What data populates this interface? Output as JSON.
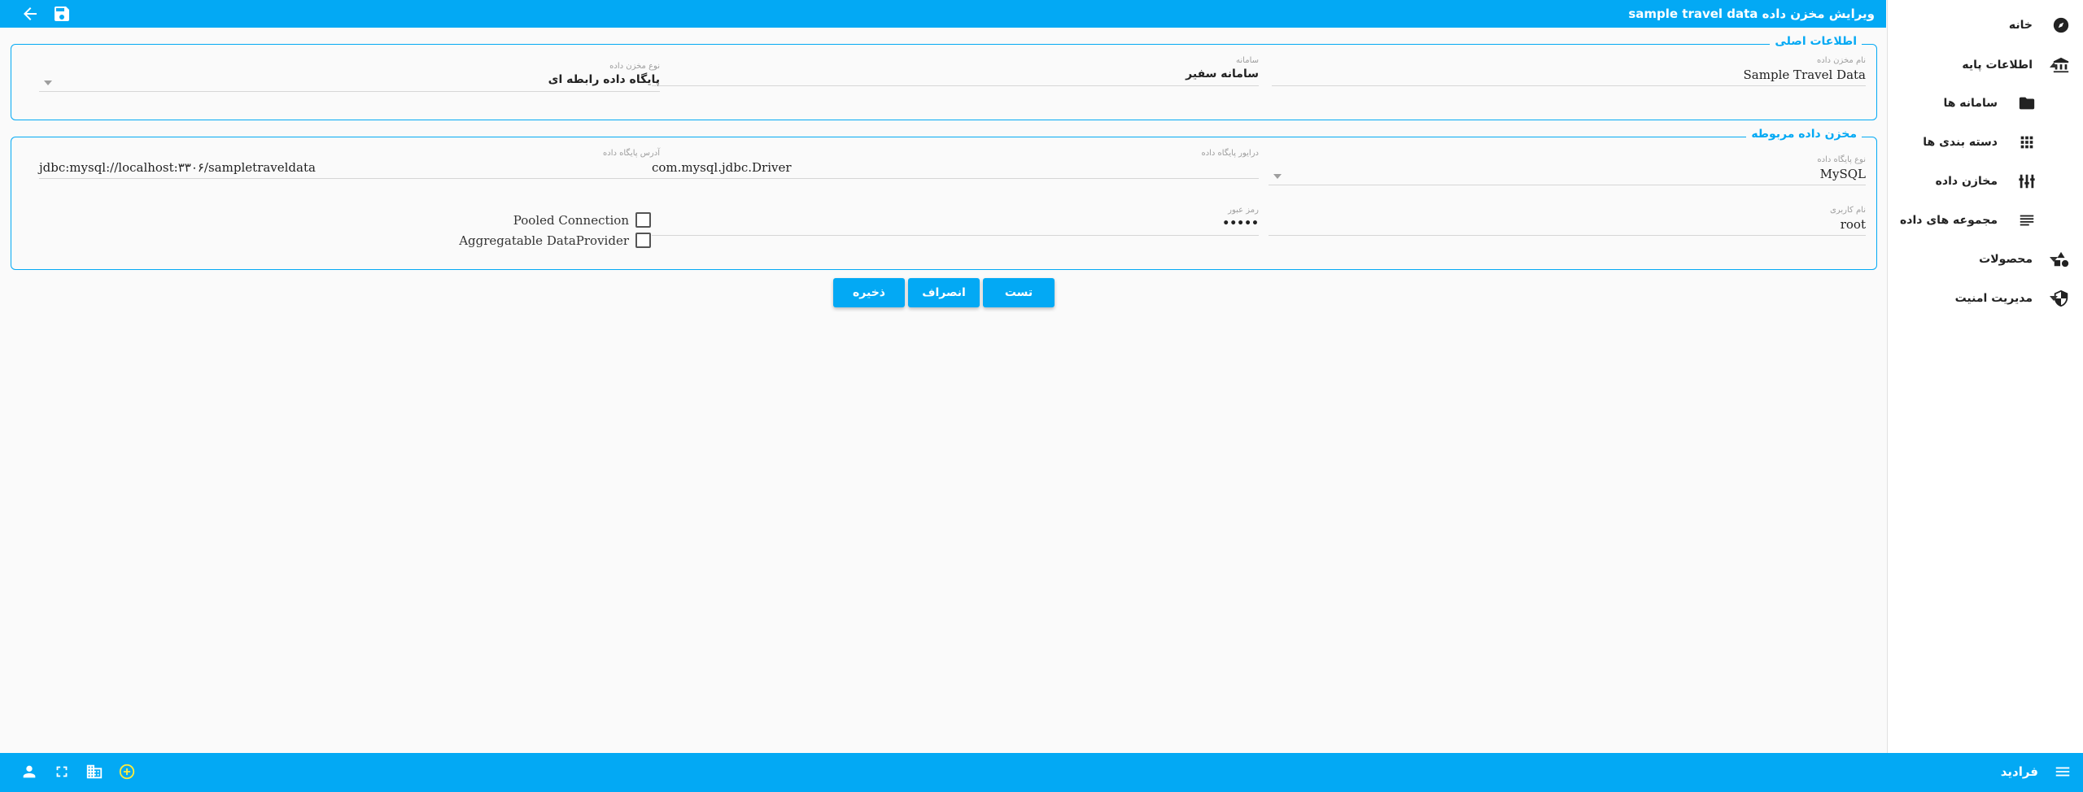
{
  "header": {
    "title": "ویرایش مخزن داده sample travel data",
    "back_icon": "arrow-back-icon",
    "save_icon": "save-icon"
  },
  "sidebar": {
    "items": [
      {
        "label": "خانه",
        "icon": "compass-icon"
      },
      {
        "label": "اطلاعات پایه",
        "icon": "bank-icon",
        "expanded": true
      },
      {
        "label": "سامانه ها",
        "icon": "folder-icon"
      },
      {
        "label": "دسته بندی ها",
        "icon": "apps-grid-icon"
      },
      {
        "label": "مخازن داده",
        "icon": "database-icon"
      },
      {
        "label": "مجموعه های داده",
        "icon": "list-icon"
      },
      {
        "label": "محصولات",
        "icon": "shapes-icon",
        "expanded": false
      },
      {
        "label": "مدیریت امنیت",
        "icon": "shield-icon",
        "expanded": false
      }
    ]
  },
  "main_info": {
    "legend": "اطلاعات اصلی",
    "name_label": "نام مخزن داده",
    "name_value": "Sample Travel Data",
    "system_label": "سامانه",
    "system_value": "سامانه سفیر",
    "type_label": "نوع مخزن داده",
    "type_value": "پایگاه داده رابطه ای"
  },
  "related_store": {
    "legend": "مخزن داده مربوطه",
    "db_type_label": "نوع پایگاه داده",
    "db_type_value": "MySQL",
    "driver_label": "درایور پایگاه داده",
    "driver_value": "com.mysql.jdbc.Driver",
    "address_label": "آدرس پایگاه داده",
    "address_value": "jdbc:mysql://localhost:۳۳۰۶/sampletraveldata",
    "username_label": "نام کاربری",
    "username_value": "root",
    "password_label": "رمز عبور",
    "password_value": "•••••",
    "pooled_label": "Pooled Connection",
    "pooled_checked": false,
    "aggregatable_label": "Aggregatable DataProvider",
    "aggregatable_checked": false
  },
  "actions": {
    "test_label": "تست",
    "cancel_label": "انصراف",
    "save_label": "ذخیره"
  },
  "footer": {
    "brand": "فرادید",
    "icons": [
      "person-icon",
      "fullscreen-icon",
      "building-icon",
      "add-circle-icon",
      "menu-icon"
    ]
  },
  "colors": {
    "accent": "#03a9f4",
    "add_icon": "#ffeb3b"
  }
}
